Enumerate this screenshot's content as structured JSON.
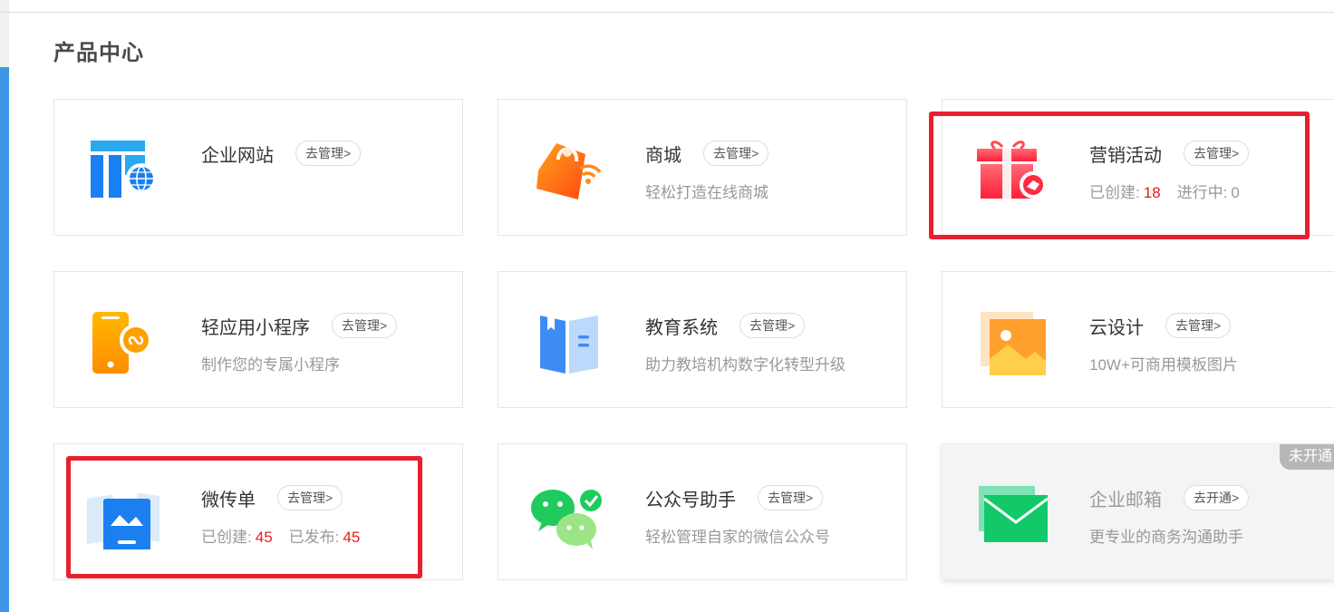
{
  "section": {
    "title": "产品中心"
  },
  "cards": {
    "website": {
      "name": "企业网站",
      "action": "去管理>"
    },
    "mall": {
      "name": "商城",
      "action": "去管理>",
      "desc": "轻松打造在线商城"
    },
    "marketing": {
      "name": "营销活动",
      "action": "去管理>",
      "created_label": "已创建:",
      "created_value": "18",
      "running_label": "进行中:",
      "running_value": "0"
    },
    "miniapp": {
      "name": "轻应用小程序",
      "action": "去管理>",
      "desc": "制作您的专属小程序"
    },
    "education": {
      "name": "教育系统",
      "action": "去管理>",
      "desc": "助力教培机构数字化转型升级"
    },
    "design": {
      "name": "云设计",
      "action": "去管理>",
      "desc": "10W+可商用模板图片"
    },
    "flyer": {
      "name": "微传单",
      "action": "去管理>",
      "created_label": "已创建:",
      "created_value": "45",
      "published_label": "已发布:",
      "published_value": "45"
    },
    "wechat": {
      "name": "公众号助手",
      "action": "去管理>",
      "desc": "轻松管理自家的微信公众号"
    },
    "email": {
      "name": "企业邮箱",
      "action": "去开通>",
      "desc": "更专业的商务沟通助手",
      "badge": "未开通"
    }
  },
  "colors": {
    "accent_red": "#e61e1e",
    "highlight": "#e8202e",
    "sidebar_blue": "#3e97e6"
  }
}
